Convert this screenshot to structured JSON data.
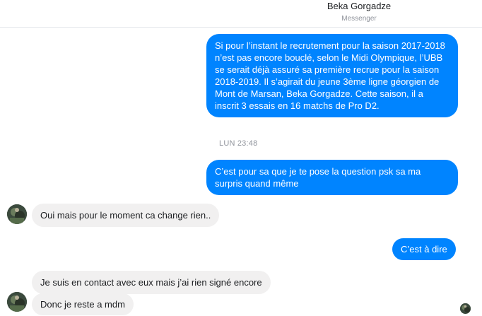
{
  "header": {
    "contact_name": "Beka Gorgadze",
    "subtitle": "Messenger"
  },
  "messages": [
    {
      "direction": "outgoing",
      "text": "Si pour l’instant le recrutement pour la saison 2017-2018 n’est pas encore bouclé, selon le Midi Olympique, l’UBB se serait déjà assuré sa première recrue pour la saison 2018-2019. Il s’agirait du jeune 3ème ligne géorgien de Mont de Marsan, Beka Gorgadze. Cette saison, il a inscrit 3 essais en 16 matchs de Pro D2."
    },
    {
      "direction": "timestamp",
      "text": "LUN 23:48"
    },
    {
      "direction": "outgoing",
      "text": "C’est pour sa que je te pose la question psk sa ma surpris quand même"
    },
    {
      "direction": "incoming",
      "text": "Oui mais pour le moment ca change rien.."
    },
    {
      "direction": "outgoing",
      "text": "C’est à dire"
    },
    {
      "direction": "incoming",
      "text": "Je suis en contact avec eux mais j’ai rien signé encore"
    },
    {
      "direction": "incoming",
      "text": "Donc je reste a mdm"
    }
  ],
  "colors": {
    "outgoing_bubble": "#0084ff",
    "incoming_bubble": "#f1f0f0",
    "timestamp_text": "#90949c"
  },
  "icons": {
    "avatar": "contact-avatar-photo",
    "read_receipt": "seen-avatar-photo"
  }
}
